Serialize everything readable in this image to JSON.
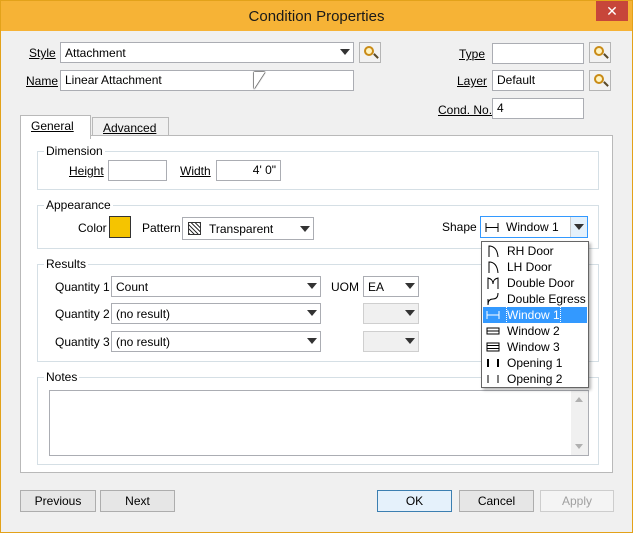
{
  "window": {
    "title": "Condition Properties",
    "close_label": "✕"
  },
  "top": {
    "style_label": "Style",
    "style_value": "Attachment",
    "name_label": "Name",
    "name_value": "Linear Attachment",
    "type_label": "Type",
    "type_value": "",
    "layer_label": "Layer",
    "layer_value": "Default",
    "cond_label": "Cond. No.",
    "cond_value": "4"
  },
  "tabs": [
    {
      "label": "General"
    },
    {
      "label": "Advanced"
    }
  ],
  "dimension": {
    "title": "Dimension",
    "height_label": "Height",
    "height_value": "",
    "width_label": "Width",
    "width_value": "4' 0\""
  },
  "appearance": {
    "title": "Appearance",
    "color_label": "Color",
    "color_value": "#f5c400",
    "pattern_label": "Pattern",
    "pattern_value": "Transparent",
    "shape_label": "Shape",
    "shape_value": "Window 1"
  },
  "shape_options": [
    {
      "label": "RH Door",
      "icon": "rh-door-icon"
    },
    {
      "label": "LH Door",
      "icon": "lh-door-icon"
    },
    {
      "label": "Double Door",
      "icon": "double-door-icon"
    },
    {
      "label": "Double Egress D",
      "icon": "double-egress-door-icon"
    },
    {
      "label": "Window 1",
      "icon": "window-1-icon",
      "selected": true
    },
    {
      "label": "Window 2",
      "icon": "window-2-icon"
    },
    {
      "label": "Window 3",
      "icon": "window-3-icon"
    },
    {
      "label": "Opening 1",
      "icon": "opening-1-icon"
    },
    {
      "label": "Opening 2",
      "icon": "opening-2-icon"
    }
  ],
  "results": {
    "title": "Results",
    "uom_label": "UOM",
    "rows": [
      {
        "label": "Quantity 1",
        "value": "Count",
        "uom": "EA"
      },
      {
        "label": "Quantity 2",
        "value": "(no result)",
        "uom": ""
      },
      {
        "label": "Quantity 3",
        "value": "(no result)",
        "uom": ""
      }
    ]
  },
  "notes": {
    "title": "Notes",
    "value": ""
  },
  "buttons": {
    "previous": "Previous",
    "next": "Next",
    "ok": "OK",
    "cancel": "Cancel",
    "apply": "Apply"
  }
}
